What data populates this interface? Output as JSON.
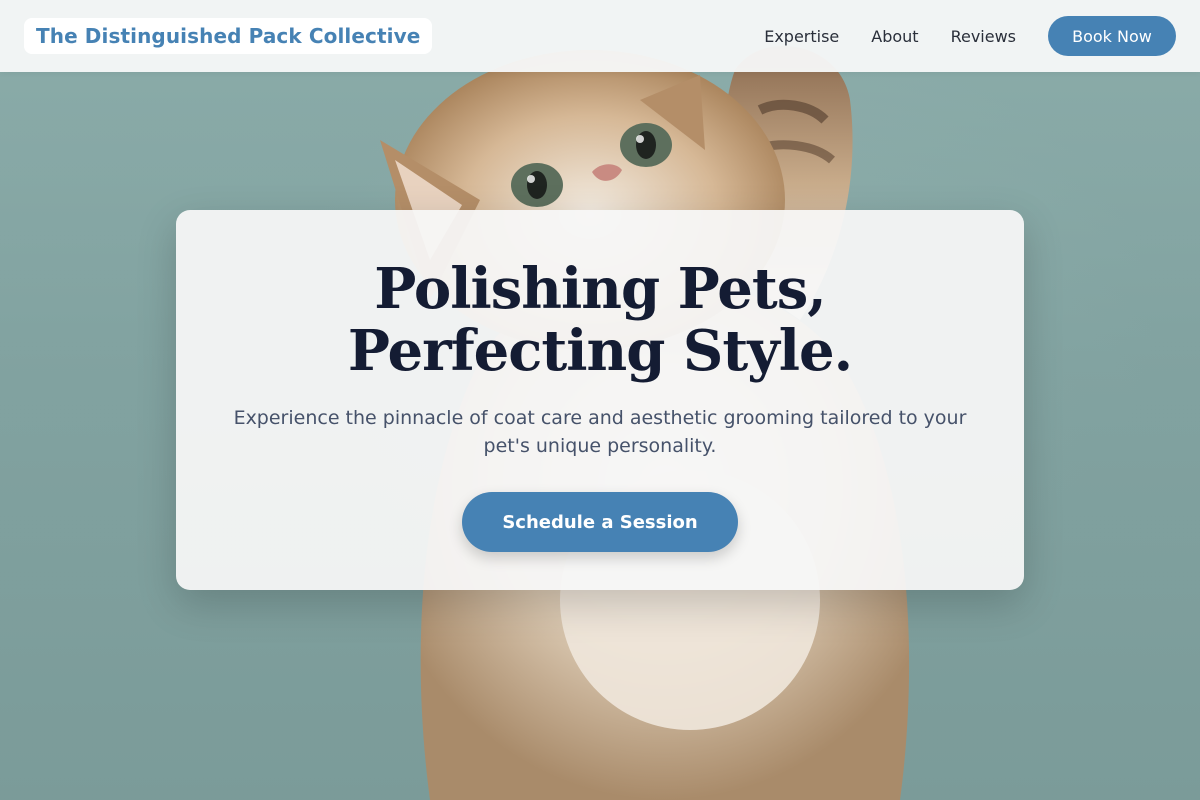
{
  "nav": {
    "brand": "The Distinguished Pack Collective",
    "links": [
      "Expertise",
      "About",
      "Reviews"
    ],
    "cta": "Book Now"
  },
  "hero": {
    "title": "Polishing Pets, Perfecting Style.",
    "subtitle": "Experience the pinnacle of coat care and aesthetic grooming tailored to your pet's unique personality.",
    "cta": "Schedule a Session",
    "background_image": "kitten-photo"
  },
  "colors": {
    "accent": "#4682b4",
    "title": "#141c33",
    "subtitle": "#46526a",
    "background": "#86a5a4"
  }
}
